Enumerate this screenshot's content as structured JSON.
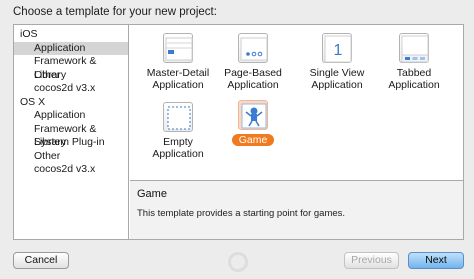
{
  "header": {
    "title": "Choose a template for your new project:"
  },
  "sidebar": {
    "groups": [
      {
        "label": "iOS",
        "items": [
          "Application",
          "Framework & Library",
          "Other",
          "cocos2d v3.x"
        ]
      },
      {
        "label": "OS X",
        "items": [
          "Application",
          "Framework & Library",
          "System Plug-in",
          "Other",
          "cocos2d v3.x"
        ]
      }
    ],
    "selected": "iOS / Application"
  },
  "templates": [
    {
      "label1": "Master-Detail",
      "label2": "Application",
      "icon": "master-detail-icon"
    },
    {
      "label1": "Page-Based",
      "label2": "Application",
      "icon": "page-based-icon"
    },
    {
      "label1": "Single View",
      "label2": "Application",
      "icon": "single-view-icon",
      "glyph": "1"
    },
    {
      "label1": "Tabbed",
      "label2": "Application",
      "icon": "tabbed-icon"
    },
    {
      "label1": "Empty",
      "label2": "Application",
      "icon": "empty-icon"
    },
    {
      "label1": "Game",
      "label2": "",
      "icon": "game-icon",
      "selected": true
    }
  ],
  "description": {
    "title": "Game",
    "text": "This template provides a starting point for games."
  },
  "buttons": {
    "cancel": "Cancel",
    "previous": "Previous",
    "next": "Next"
  },
  "colors": {
    "selection": "#f07a1d",
    "accent": "#3b7bd0"
  }
}
